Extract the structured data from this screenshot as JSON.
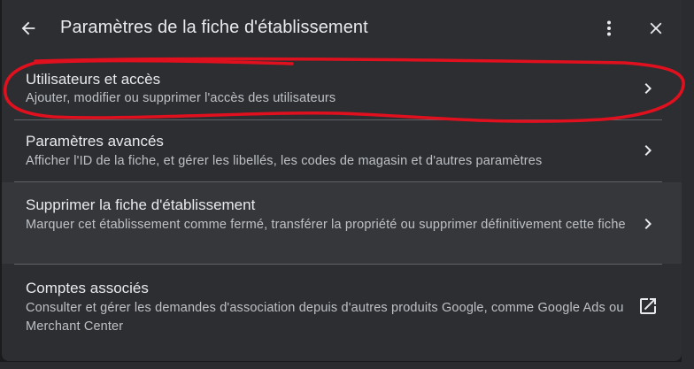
{
  "header": {
    "title": "Paramètres de la fiche d'établissement",
    "back_icon": "arrow-left-icon",
    "more_icon": "more-vert-icon",
    "close_icon": "close-icon"
  },
  "items": [
    {
      "title": "Utilisateurs et accès",
      "subtitle": "Ajouter, modifier ou supprimer l'accès des utilisateurs",
      "icon": "chevron-right-icon"
    },
    {
      "title": "Paramètres avancés",
      "subtitle": "Afficher l'ID de la fiche, et gérer les libellés, les codes de magasin et d'autres paramètres",
      "icon": "chevron-right-icon"
    },
    {
      "title": "Supprimer la fiche d'établissement",
      "subtitle": "Marquer cet établissement comme fermé, transférer la propriété ou supprimer définitivement cette fiche",
      "icon": "chevron-right-icon"
    },
    {
      "title": "Comptes associés",
      "subtitle": "Consulter et gérer les demandes d'association depuis d'autres produits Google, comme Google Ads ou Merchant Center",
      "icon": "open-in-new-icon"
    }
  ],
  "colors": {
    "dialog_bg": "#2d2e31",
    "hover_bg": "#36373a",
    "text_primary": "#e8eaed",
    "text_secondary": "#bdc1c6",
    "annotation": "#e0101e"
  }
}
